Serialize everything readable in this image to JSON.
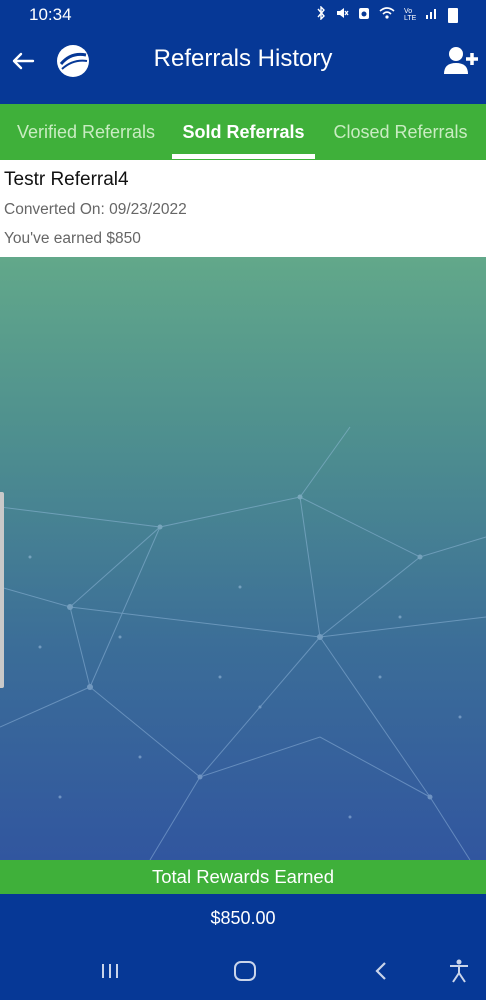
{
  "status_bar": {
    "time": "10:34",
    "icons": [
      "bluetooth-icon",
      "mute-icon",
      "alarm-icon",
      "wifi-icon",
      "volte-icon",
      "signal-icon",
      "battery-icon"
    ],
    "volte_label": "Vo LTE"
  },
  "header": {
    "title": "Referrals History",
    "back_icon": "arrow-left-icon",
    "logo_icon": "app-logo-icon",
    "action_icon": "add-user-icon"
  },
  "tabs": [
    {
      "label": "Verified Referrals",
      "selected": false
    },
    {
      "label": "Sold Referrals",
      "selected": true
    },
    {
      "label": "Closed Referrals",
      "selected": false
    }
  ],
  "referrals": [
    {
      "name": "Testr Referral4",
      "converted": "Converted On: 09/23/2022",
      "earned": "You've earned $850"
    }
  ],
  "footer": {
    "total_label": "Total Rewards Earned",
    "total_amount": "$850.00"
  },
  "nav_bar": {
    "icons": [
      "recent-apps-icon",
      "home-icon",
      "back-icon",
      "accessibility-icon"
    ]
  },
  "colors": {
    "primary": "#063896",
    "accent": "#3fb03a",
    "card": "#ffffff"
  }
}
